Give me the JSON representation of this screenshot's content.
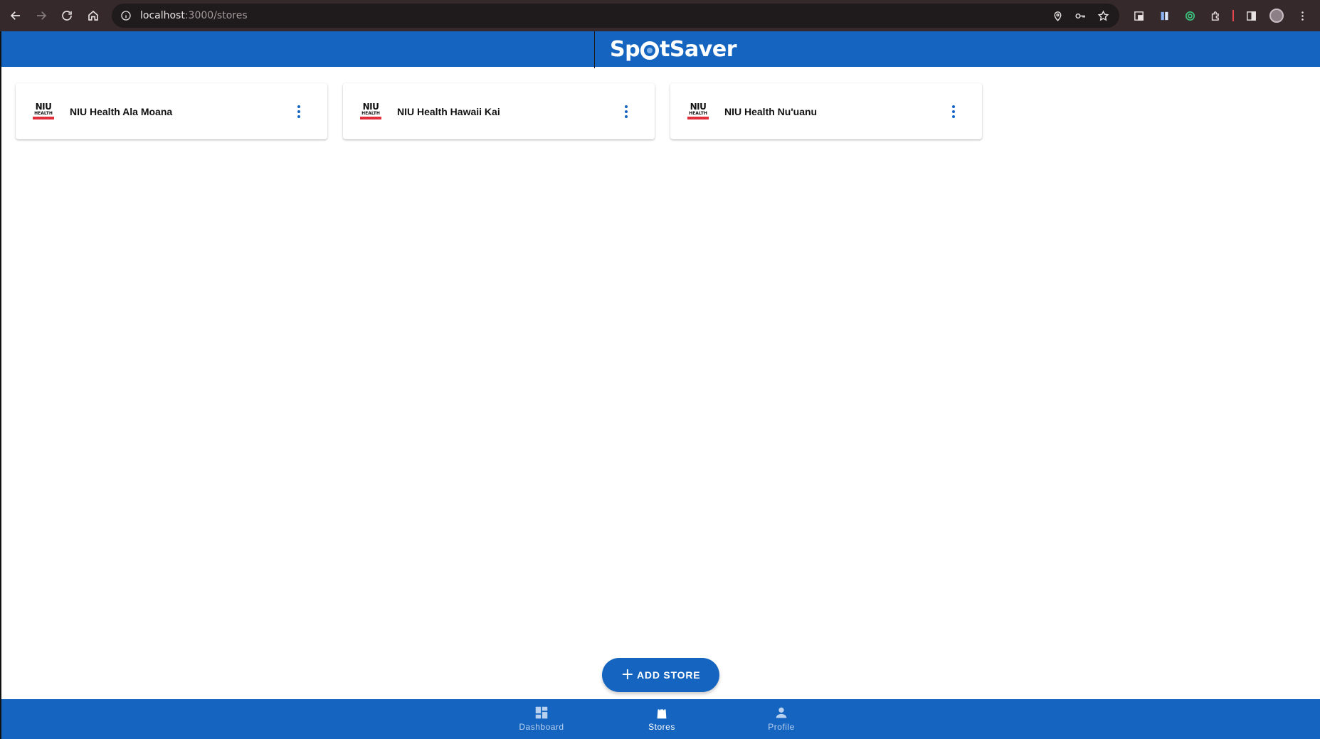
{
  "browser": {
    "url_host": "localhost",
    "url_path": ":3000/stores"
  },
  "header": {
    "logo_text_before": "Sp",
    "logo_text_after": "tSaver"
  },
  "stores": [
    {
      "name": "NIU Health Ala Moana",
      "logo_top": "NIU",
      "logo_sub": "HEALTH"
    },
    {
      "name": "NIU Health Hawaii Kai",
      "logo_top": "NIU",
      "logo_sub": "HEALTH"
    },
    {
      "name": "NIU Health Nu'uanu",
      "logo_top": "NIU",
      "logo_sub": "HEALTH"
    }
  ],
  "fab": {
    "label": "ADD STORE",
    "icon": "plus-icon"
  },
  "bottom_nav": {
    "items": [
      {
        "label": "Dashboard",
        "icon": "dashboard-icon",
        "active": false
      },
      {
        "label": "Stores",
        "icon": "shopping-bag-icon",
        "active": true
      },
      {
        "label": "Profile",
        "icon": "person-icon",
        "active": false
      }
    ]
  },
  "colors": {
    "primary": "#1565c0",
    "chrome_bg": "#35292c"
  }
}
